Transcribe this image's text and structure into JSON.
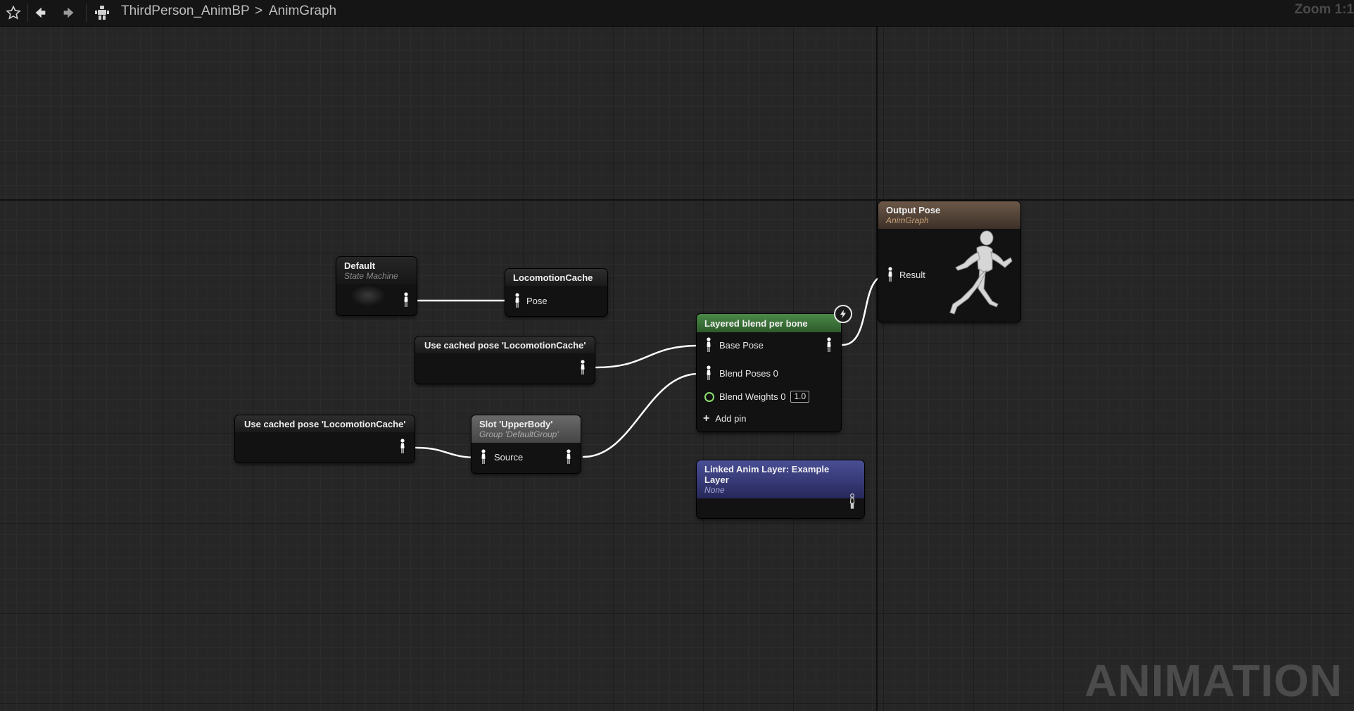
{
  "toolbar": {
    "blueprint_name": "ThirdPerson_AnimBP",
    "separator": ">",
    "graph_name": "AnimGraph",
    "zoom_label": "Zoom 1:1"
  },
  "nodes": {
    "state_machine": {
      "title": "Default",
      "subtitle": "State Machine"
    },
    "locomotion_cache": {
      "title": "LocomotionCache",
      "pin_pose": "Pose"
    },
    "cached_pose_1": {
      "title": "Use cached pose 'LocomotionCache'"
    },
    "cached_pose_2": {
      "title": "Use cached pose 'LocomotionCache'"
    },
    "slot": {
      "title": "Slot 'UpperBody'",
      "subtitle": "Group 'DefaultGroup'",
      "pin_source": "Source"
    },
    "layered_blend": {
      "title": "Layered blend per bone",
      "pin_base_pose": "Base Pose",
      "pin_blend_poses": "Blend Poses 0",
      "pin_blend_weights": "Blend Weights 0",
      "blend_weight_value": "1.0",
      "add_pin": "Add pin"
    },
    "linked_anim_layer": {
      "title": "Linked Anim Layer: Example Layer",
      "subtitle": "None"
    },
    "output_pose": {
      "title": "Output Pose",
      "subtitle": "AnimGraph",
      "pin_result": "Result"
    }
  },
  "watermark": "ANIMATION",
  "colors": {
    "header_green": "#4b8a48",
    "header_blue": "#4a4f96",
    "header_tan": "#6b5848",
    "wire": "#ffffff",
    "float_pin": "#8ee06e"
  }
}
